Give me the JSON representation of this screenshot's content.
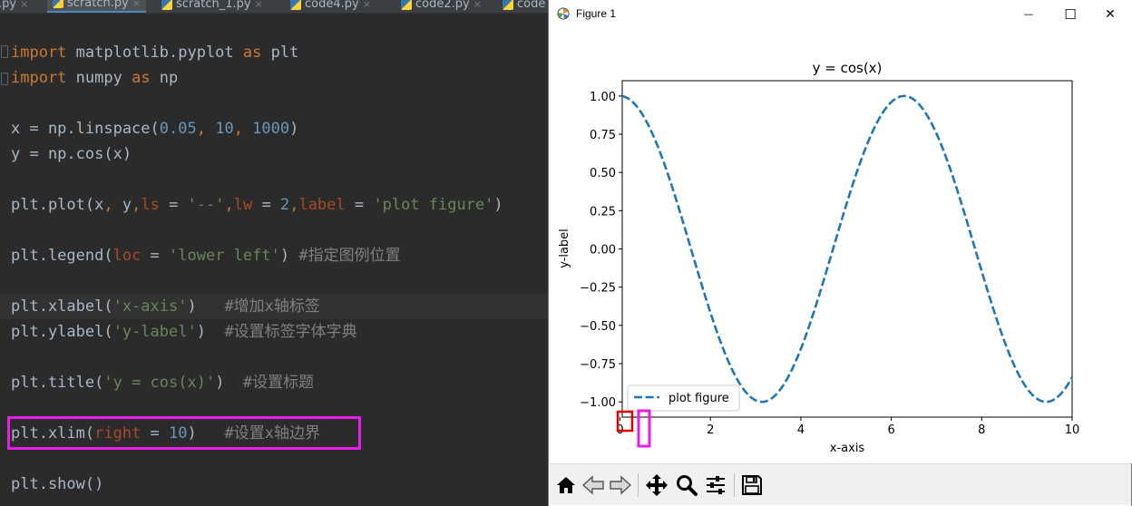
{
  "editor": {
    "tabs": [
      {
        "label": ".py",
        "active": false
      },
      {
        "label": "scratch.py",
        "active": true
      },
      {
        "label": "scratch_1.py",
        "active": false
      },
      {
        "label": "code4.py",
        "active": false
      },
      {
        "label": "code2.py",
        "active": false
      },
      {
        "label": "code",
        "active": false
      }
    ],
    "tab_close": "×",
    "lines": {
      "l1": {
        "kw1": "import",
        "mod": " matplotlib.pyplot ",
        "kw2": "as",
        "alias": " plt"
      },
      "l2": {
        "kw1": "import",
        "mod": " numpy ",
        "kw2": "as",
        "alias": " np"
      },
      "l4": {
        "a": "x = np.linspace(",
        "n1": "0.05",
        "c1": ", ",
        "n2": "10",
        "c2": ", ",
        "n3": "1000",
        "b": ")"
      },
      "l5": {
        "a": "y = np.cos(x)"
      },
      "l7": {
        "a": "plt.plot(x",
        "c1": ", ",
        "b": "y",
        "c2": ",",
        "p1": "ls",
        "e1": " = ",
        "s1": "'--'",
        "c3": ",",
        "p2": "lw",
        "e2": " = ",
        "n1": "2",
        "c4": ",",
        "p3": "label",
        "e3": " = ",
        "s2": "'plot figure'",
        "z": ")"
      },
      "l9": {
        "a": "plt.legend(",
        "p1": "loc",
        "e1": " = ",
        "s1": "'lower left'",
        "b": ") ",
        "cm": "#指定图例位置"
      },
      "l11": {
        "a": "plt.xlabel(",
        "s1": "'x-axis'",
        "b": ")   ",
        "cm": "#增加x轴标签"
      },
      "l12": {
        "a": "plt.ylabel(",
        "s1": "'y-label'",
        "b": ")  ",
        "cm": "#设置标签字体字典"
      },
      "l14": {
        "a": "plt.title(",
        "s1": "'y = cos(x)'",
        "b": ")  ",
        "cm": "#设置标题"
      },
      "l16": {
        "a": "plt.xlim(",
        "p1": "right",
        "e1": " = ",
        "n1": "10",
        "b": ")   ",
        "cm": "#设置x轴边界"
      },
      "l18": {
        "a": "plt.show()"
      }
    }
  },
  "figure_window": {
    "title": "Figure 1",
    "minimize": "—",
    "maximize": "☐",
    "close": "✕",
    "toolbar": [
      "home-icon",
      "back-icon",
      "forward-icon",
      "pan-icon",
      "zoom-icon",
      "configure-subplots-icon",
      "save-icon"
    ]
  },
  "chart_data": {
    "type": "line",
    "title": "y = cos(x)",
    "xlabel": "x-axis",
    "ylabel": "y-label",
    "xlim": [
      0.05,
      10
    ],
    "ylim": [
      -1.1,
      1.1
    ],
    "xticks": [
      "0",
      "2",
      "4",
      "6",
      "8",
      "10"
    ],
    "yticks": [
      "1.00",
      "0.75",
      "0.50",
      "0.25",
      "0.00",
      "−0.25",
      "−0.50",
      "−0.75",
      "−1.00"
    ],
    "series": [
      {
        "name": "plot figure",
        "function": "cos",
        "x_start": 0.05,
        "x_end": 10,
        "n_points": 1000,
        "linestyle": "dashed",
        "linewidth": 2,
        "color": "#1f77b4"
      }
    ],
    "legend_position": "lower left",
    "grid": false
  },
  "annotations": {
    "code_highlight_color": "#e61ee6",
    "tick_zero_highlight_color": "#e61ee6",
    "axis_corner_highlight_color": "#e00000"
  }
}
